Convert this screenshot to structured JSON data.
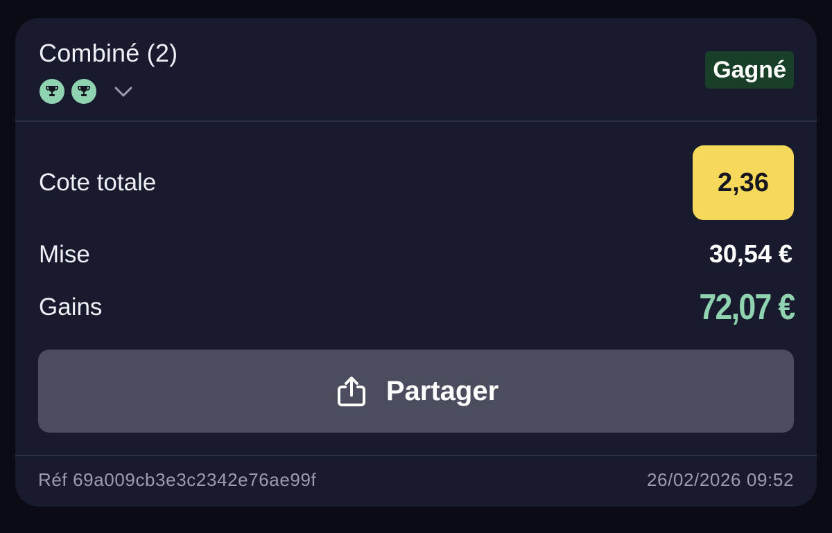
{
  "bet": {
    "title": "Combiné (2)",
    "status": "Gagné",
    "selections": [
      {
        "icon": "trophy-icon",
        "status_color": "#8fd3b0"
      },
      {
        "icon": "trophy-icon",
        "status_color": "#8fd3b0"
      }
    ]
  },
  "summary": {
    "odds_label": "Cote totale",
    "odds_value": "2,36",
    "stake_label": "Mise",
    "stake_value": "30,54 €",
    "gains_label": "Gains",
    "gains_value": "72,07 €"
  },
  "actions": {
    "share_label": "Partager"
  },
  "footer": {
    "reference": "Réf 69a009cb3e3c2342e76ae99f",
    "datetime": "26/02/2026 09:52"
  },
  "colors": {
    "background": "#0a0b14",
    "card": "#181b2e",
    "win_badge": "#183f27",
    "odds_highlight": "#f6d95a",
    "gains": "#8fd3b0",
    "button": "#4a4d5e"
  }
}
